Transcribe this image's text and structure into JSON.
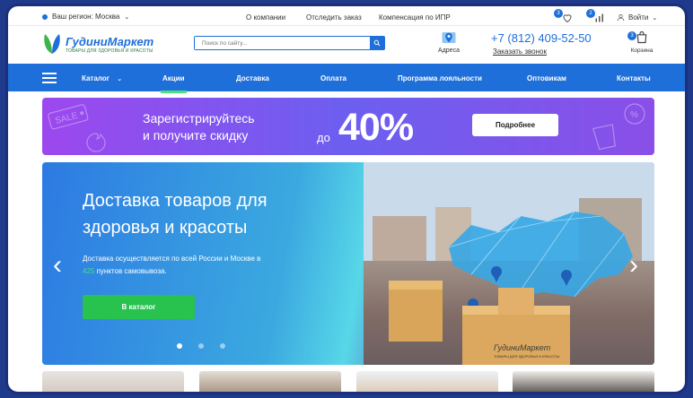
{
  "topbar": {
    "region_label": "Ваш регион: Москва",
    "links": [
      "О компании",
      "Отследить заказ",
      "Компенсация по ИПР"
    ],
    "favorites_count": "3",
    "compare_count": "2",
    "login_label": "Войти"
  },
  "header": {
    "logo_name": "ГудиниМаркет",
    "logo_tagline": "ТОВАРЫ ДЛЯ ЗДОРОВЬЯ И КРАСОТЫ",
    "search_placeholder": "Поиск по сайту...",
    "address_label": "Адреса",
    "phone": "+7 (812) 409-52-50",
    "callback_label": "Заказать звонок",
    "cart_count": "3",
    "cart_label": "Корзина"
  },
  "nav": {
    "items": [
      "Каталог",
      "Акции",
      "Доставка",
      "Оплата",
      "Программа лояльности",
      "Оптовикам",
      "Контакты"
    ],
    "active_index": 1
  },
  "promo": {
    "line1": "Зарегистрируйтесь",
    "line2": "и получите скидку",
    "prefix": "до",
    "discount": "40%",
    "button": "Подробнее",
    "sale_tag": "SALE"
  },
  "hero": {
    "title_line1": "Доставка товаров для",
    "title_line2": "здоровья и красоты",
    "sub_line1": "Доставка осуществляется по всей России и Москве в",
    "sub_count": "425",
    "sub_line2": "пунктов самовывоза.",
    "button": "В каталог",
    "box_brand": "ГудиниМаркет",
    "box_tagline": "ТОВАРЫ ДЛЯ ЗДОРОВЬЯ И КРАСОТЫ",
    "slides_total": 3,
    "active_slide": 1
  },
  "colors": {
    "brand_blue": "#1e6fd9",
    "accent_green": "#28c24f",
    "promo_purple": "#9c48ee"
  }
}
